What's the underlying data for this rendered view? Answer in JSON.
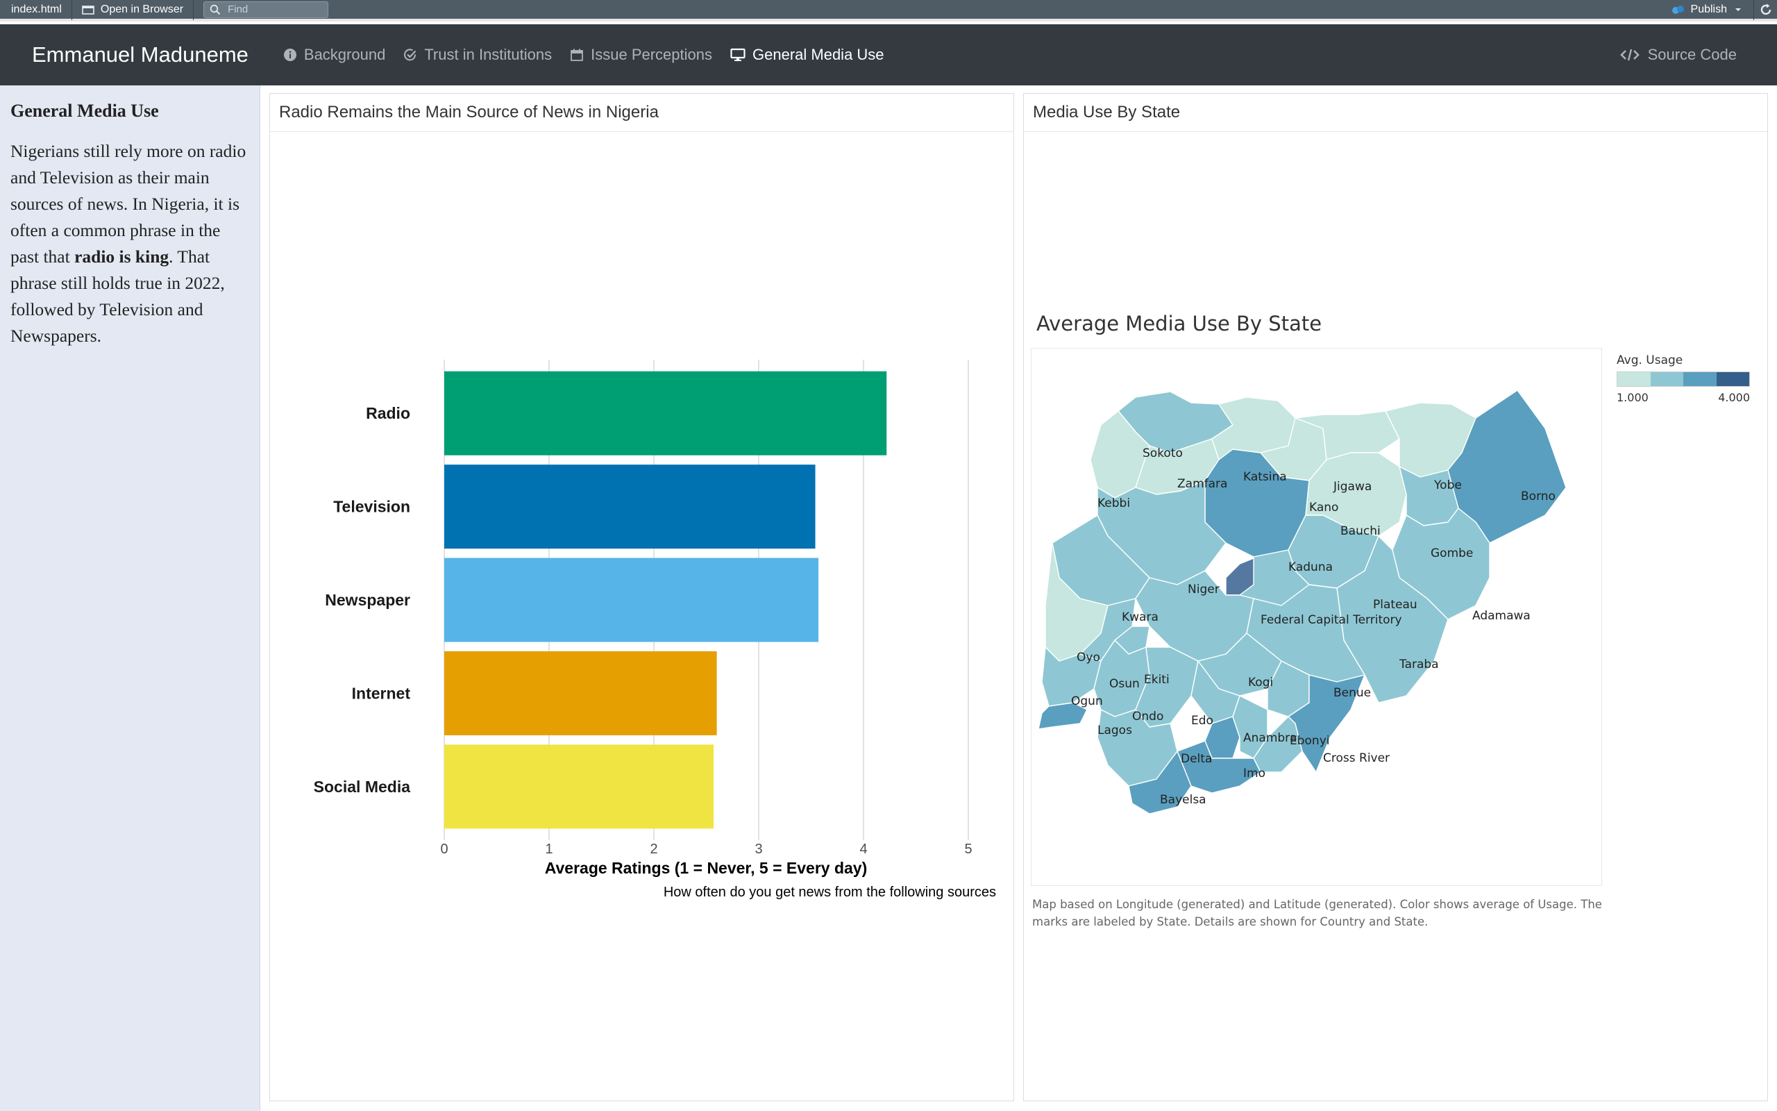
{
  "viewer": {
    "file_tab": "index.html",
    "open_browser_label": "Open in Browser",
    "find_placeholder": "Find",
    "publish_label": "Publish"
  },
  "navbar": {
    "brand": "Emmanuel Maduneme",
    "items": [
      {
        "label": "Background",
        "icon": "info-circle-icon",
        "active": false
      },
      {
        "label": "Trust in Institutions",
        "icon": "check-circle-icon",
        "active": false
      },
      {
        "label": "Issue Perceptions",
        "icon": "calendar-icon",
        "active": false
      },
      {
        "label": "General Media Use",
        "icon": "monitor-icon",
        "active": true
      }
    ],
    "source_code_label": "Source Code"
  },
  "sidebar": {
    "title": "General Media Use",
    "text_before": "Nigerians still rely more on radio and Television as their main sources of news. In Nigeria, it is often a common phrase in the past that ",
    "text_bold": "radio is king",
    "text_after": ". That phrase still holds true in 2022, followed by Television and Newspapers."
  },
  "left_panel": {
    "title": "Radio Remains the Main Source of News in Nigeria"
  },
  "right_panel": {
    "title": "Media Use By State",
    "map_title": "Average Media Use By State",
    "legend_title": "Avg. Usage",
    "legend_min": "1.000",
    "legend_max": "4.000",
    "legend_colors": [
      "#c6e6df",
      "#8ec7d3",
      "#5a9fbf",
      "#355f8b"
    ],
    "caption": "Map based on Longitude (generated) and Latitude (generated).  Color shows average of Usage.  The marks are labeled by State.  Details are shown for Country and State.",
    "state_labels": [
      "Sokoto",
      "Zamfara",
      "Katsina",
      "Jigawa",
      "Yobe",
      "Borno",
      "Kebbi",
      "Kano",
      "Bauchi",
      "Gombe",
      "Kaduna",
      "Niger",
      "Plateau",
      "Adamawa",
      "Kwara",
      "Federal Capital Territory",
      "Oyo",
      "Taraba",
      "Osun",
      "Ekiti",
      "Kogi",
      "Benue",
      "Ogun",
      "Ondo",
      "Edo",
      "Lagos",
      "Anambra",
      "Ebonyi",
      "Delta",
      "Imo",
      "Cross River",
      "Bayelsa"
    ]
  },
  "chart_data": {
    "type": "bar",
    "orientation": "horizontal",
    "categories": [
      "Radio",
      "Television",
      "Newspaper",
      "Internet",
      "Social Media"
    ],
    "values": [
      4.22,
      3.54,
      3.57,
      2.6,
      2.57
    ],
    "colors": [
      "#009e73",
      "#0072b2",
      "#56b4e9",
      "#e69f00",
      "#f0e442"
    ],
    "xlim": [
      0,
      5
    ],
    "xticks": [
      "0",
      "1",
      "2",
      "3",
      "4",
      "5"
    ],
    "xlabel": "Average Ratings (1 = Never, 5 = Every day)",
    "caption": "How often do you get news from the following sources",
    "grid": true
  }
}
